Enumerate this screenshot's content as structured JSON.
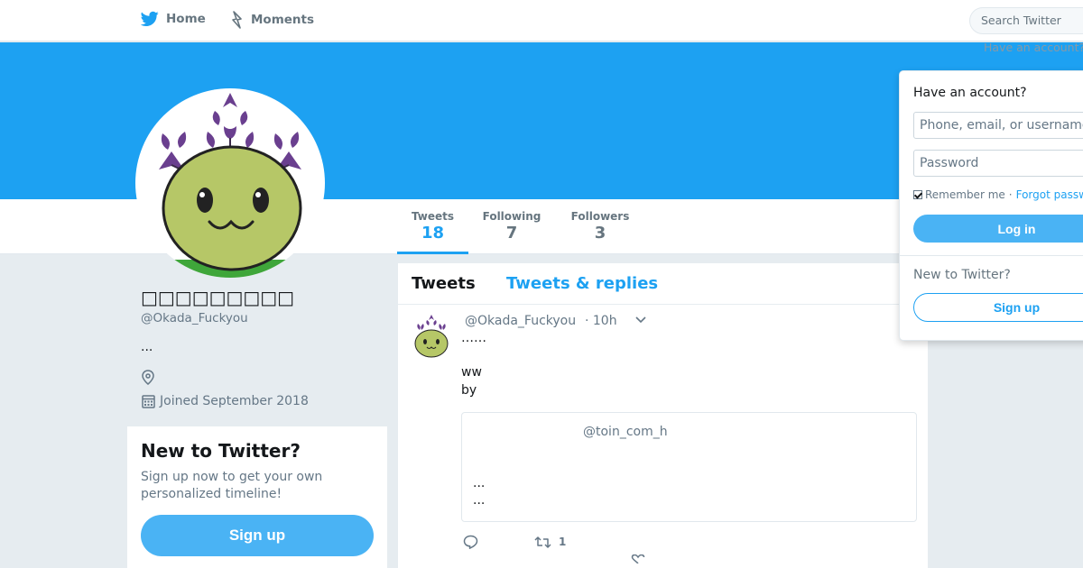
{
  "nav": {
    "home_label": "Home",
    "moments_label": "Moments",
    "search_placeholder": "Search Twitter",
    "have_account_link": "Have an account?"
  },
  "colors": {
    "brand_blue": "#1da1f2",
    "button_blue": "#4ab3f4",
    "background": "#e6ecf0"
  },
  "profile": {
    "display_name": "□□□□□□□□□",
    "handle": "@Okada_Fuckyou",
    "bio": "...",
    "joined": "Joined September 2018"
  },
  "stats": [
    {
      "label": "Tweets",
      "value": "18"
    },
    {
      "label": "Following",
      "value": "7"
    },
    {
      "label": "Followers",
      "value": "3"
    }
  ],
  "signup_card": {
    "title": "New to Twitter?",
    "text": "Sign up now to get your own personalized timeline!",
    "button": "Sign up"
  },
  "timeline": {
    "tabs": [
      "Tweets",
      "Tweets & replies"
    ],
    "tweet": {
      "handle": "@Okada_Fuckyou",
      "time": "· 10h",
      "lines": [
        "……",
        "ww",
        "by"
      ],
      "quote": {
        "handle": "@toin_com_h",
        "lines": [
          "...",
          "..."
        ]
      },
      "retweet_count": "1"
    }
  },
  "login": {
    "title": "Have an account?",
    "username_placeholder": "Phone, email, or username",
    "password_placeholder": "Password",
    "remember": "Remember me",
    "separator": "·",
    "forgot": "Forgot password?",
    "login_button": "Log in",
    "new_to_twitter": "New to Twitter?",
    "signup_button": "Sign up"
  }
}
